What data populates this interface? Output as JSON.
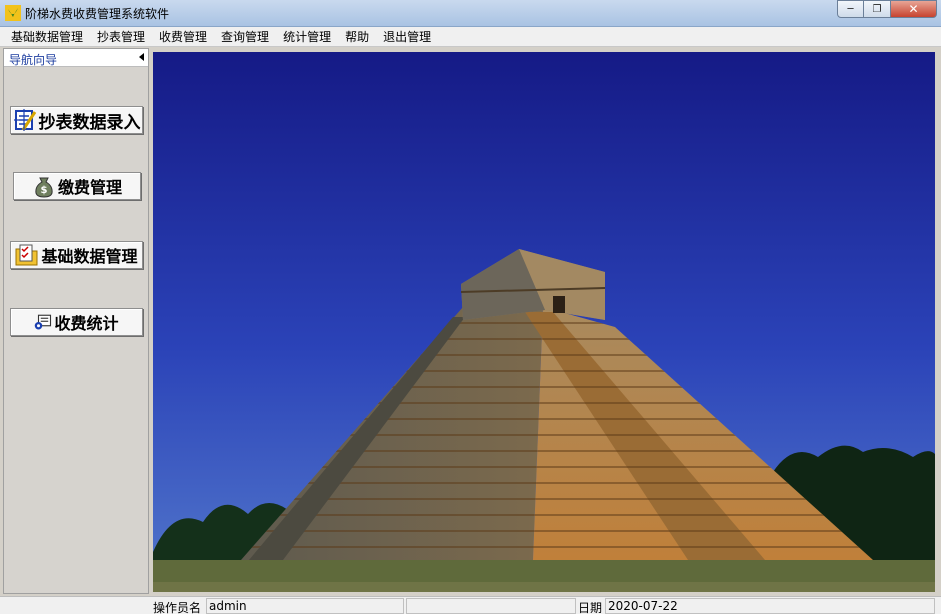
{
  "window": {
    "title": "阶梯水费收费管理系统软件",
    "app_icon": "water-drop-leaf-icon"
  },
  "menu": [
    {
      "label": "基础数据管理"
    },
    {
      "label": "抄表管理"
    },
    {
      "label": "收费管理"
    },
    {
      "label": "查询管理"
    },
    {
      "label": "统计管理"
    },
    {
      "label": "帮助"
    },
    {
      "label": "退出管理"
    }
  ],
  "nav": {
    "header": "导航向导",
    "buttons": [
      {
        "label": "抄表数据录入",
        "icon": "meter-entry-icon"
      },
      {
        "label": "缴费管理",
        "icon": "money-bag-icon"
      },
      {
        "label": "基础数据管理",
        "icon": "folder-checklist-icon"
      },
      {
        "label": "收费统计",
        "icon": "statistics-icon"
      }
    ]
  },
  "status": {
    "operator_label": "操作员名",
    "operator_value": "admin",
    "date_label": "日期",
    "date_value": "2020-07-22"
  },
  "colors": {
    "nav_header_text": "#1f3fa0",
    "sky_top": "#1a1f8c",
    "sky_bottom": "#3f63c6",
    "pyramid": "#b07a3a"
  }
}
